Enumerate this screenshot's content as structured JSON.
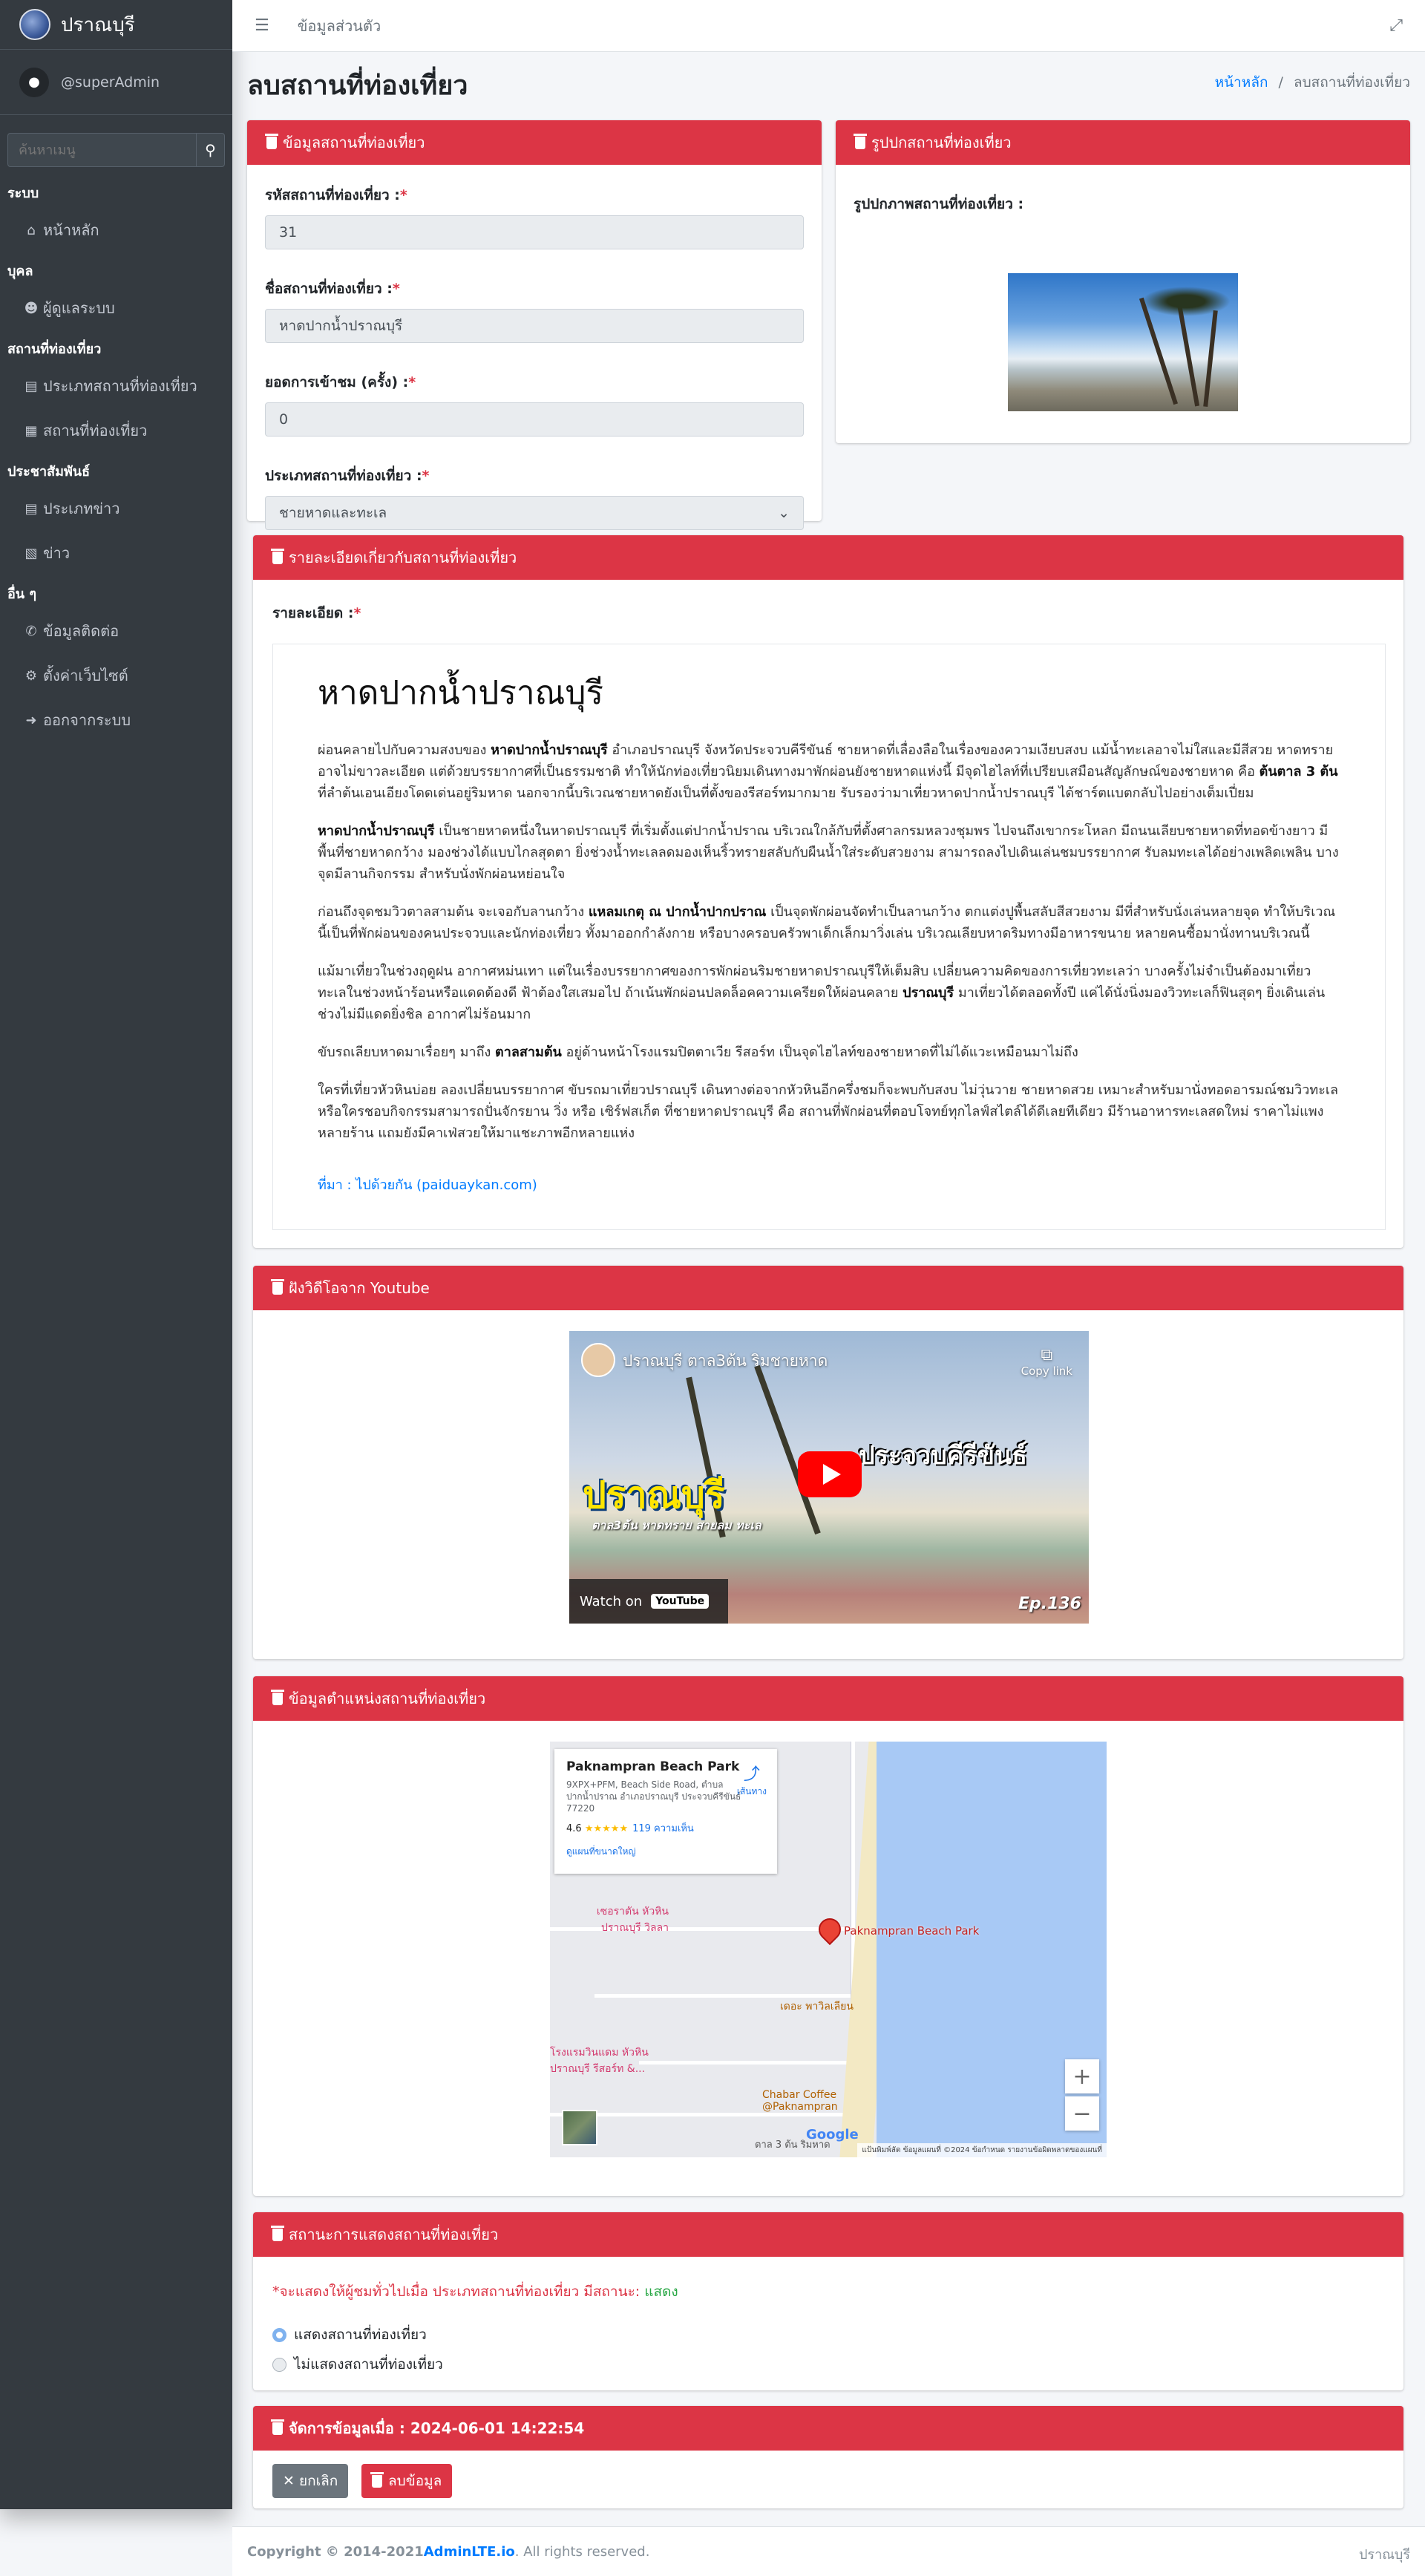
{
  "app": {
    "brand": "ปราณบุรี",
    "user": "@superAdmin"
  },
  "sidebar": {
    "search_placeholder": "ค้นหาเมนู",
    "sections": [
      {
        "header": "ระบบ",
        "items": [
          {
            "label": "หน้าหลัก",
            "icon": "home-icon"
          }
        ]
      },
      {
        "header": "บุคล",
        "items": [
          {
            "label": "ผู้ดูแลระบบ",
            "icon": "users-cog-icon"
          }
        ]
      },
      {
        "header": "สถานที่ท่องเที่ยว",
        "items": [
          {
            "label": "ประเภทสถานที่ท่องเที่ยว",
            "icon": "book-icon"
          },
          {
            "label": "สถานที่ท่องเที่ยว",
            "icon": "map-marked-icon"
          }
        ]
      },
      {
        "header": "ประชาสัมพันธ์",
        "items": [
          {
            "label": "ประเภทข่าว",
            "icon": "book-icon"
          },
          {
            "label": "ข่าว",
            "icon": "newspaper-icon"
          }
        ]
      },
      {
        "header": "อื่น ๆ",
        "items": [
          {
            "label": "ข้อมูลติดต่อ",
            "icon": "phone-icon"
          },
          {
            "label": "ตั้งค่าเว็บไซต์",
            "icon": "cogs-icon"
          },
          {
            "label": "ออกจากระบบ",
            "icon": "sign-out-icon"
          }
        ]
      }
    ]
  },
  "topbar": {
    "link": "ข้อมูลส่วนตัว"
  },
  "page": {
    "title": "ลบสถานที่ท่องเที่ยว",
    "breadcrumb_home": "หน้าหลัก",
    "breadcrumb_sep": "/",
    "breadcrumb_current": "ลบสถานที่ท่องเที่ยว"
  },
  "info_card": {
    "header": "ข้อมูลสถานที่ท่องเที่ยว",
    "id_label": "รหัสสถานที่ท่องเที่ยว :",
    "id_value": "31",
    "name_label": "ชื่อสถานที่ท่องเที่ยว :",
    "name_value": "หาดปากน้ำปราณบุรี",
    "visits_label": "ยอดการเข้าชม (ครั้ง) :",
    "visits_value": "0",
    "type_label": "ประเภทสถานที่ท่องเที่ยว :",
    "type_value": "ชายหาดและทะเล",
    "required_mark": "*"
  },
  "cover_card": {
    "header": "รูปปกสถานที่ท่องเที่ยว",
    "label": "รูปปกภาพสถานที่ท่องเที่ยว :"
  },
  "detail_card": {
    "header": "รายละเอียดเกี่ยวกับสถานที่ท่องเที่ยว",
    "label": "รายละเอียด :",
    "title": "หาดปากน้ำปราณบุรี",
    "p1_a": "ผ่อนคลายไปกับความสงบของ ",
    "p1_b": "หาดปากน้ำปราณบุรี",
    "p1_c": " อำเภอปราณบุรี จังหวัดประจวบคีรีขันธ์  ชายหาดที่เลื่องลือในเรื่องของความเงียบสงบ แม้น้ำทะเลอาจไม่ใสและมีสีสวย หาดทรายอาจไม่ขาวละเอียด แต่ด้วยบรรยากาศที่เป็นธรรมชาติ ทำให้นักท่องเที่ยวนิยมเดินทางมาพักผ่อนยังชายหาดแห่งนี้   มีจุดไฮไลท์ที่เปรียบเสมือนสัญลักษณ์ของชายหาด คือ ",
    "p1_d": "ต้นตาล 3 ต้น",
    "p1_e": " ที่ลำต้นเอนเอียงโดดเด่นอยู่ริมหาด นอกจากนี้บริเวณชายหาดยังเป็นที่ตั้งของรีสอร์ทมากมาย รับรองว่ามาเที่ยวหาดปากน้ำปราณบุรี ได้ชาร์ตแบตกลับไปอย่างเต็มเปี่ยม",
    "p2_a": "หาดปากน้ำปราณบุรี",
    "p2_b": " เป็นชายหาดหนึ่งในหาดปราณบุรี ที่เริ่มตั้งแต่ปากน้ำปราณ บริเวณใกล้กับที่ตั้งศาลกรมหลวงชุมพร ไปจนถึงเขากระโหลก มีถนนเลียบชายหาดที่ทอดข้างยาว   มีพื้นที่ชายหาดกว้าง   มองช่วงได้แบบไกลสุดตา   ยิ่งช่วงน้ำทะเลลดมองเห็นริ้วทรายสลับกับผืนน้ำใส่ระดับสวยงาม   สามารถลงไปเดินเล่นชมบรรยากาศ   รับลมทะเลได้อย่างเพลิดเพลิน บางจุดมีลานกิจกรรม สำหรับนั่งพักผ่อนหย่อนใจ",
    "p3_a": "ก่อนถึงจุดชมวิวตาลสามต้น จะเจอกับลานกว้าง ",
    "p3_b": "แหลมเกตุ ณ ปากน้ำปากปราณ",
    "p3_c": " เป็นจุดพักผ่อนจัดทำเป็นลานกว้าง ตกแต่งปูพื้นสลับสีสวยงาม มีที่สำหรับนั่งเล่นหลายจุด ทำให้บริเวณนี้เป็นที่พักผ่อนของคนประจวบและนักท่องเที่ยว ทั้งมาออกกำลังกาย   หรือบางครอบครัวพาเด็กเล็กมาวิ่งเล่น บริเวณเลียบหาดริมทางมีอาหารขนาย  หลายคนซื้อมานั่งทานบริเวณนี้",
    "p4_a": "แม้มาเที่ยวในช่วงฤดูฝน อากาศหม่นเทา แต่ในเรื่องบรรยากาศของการพักผ่อนริมชายหาดปราณบุรีให้เต็มสิบ เปลี่ยนความคิดของการเที่ยวทะเลว่า บางครั้งไม่จำเป็นต้องมาเที่ยวทะเลในช่วงหน้าร้อนหรือแดดต้องดี ฟ้าต้องใสเสมอไป ถ้าเน้นพักผ่อนปลดล็อคความเครียดให้ผ่อนคลาย ",
    "p4_b": "ปราณบุรี",
    "p4_c": "  มาเที่ยวได้ตลอดทั้งปี แค่ได้นั่งนิ่งมองวิวทะเลก็ฟินสุดๆ ยิ่งเดินเล่นช่วงไม่มีแดดยิ่งชิล อากาศไม่ร้อนมาก",
    "p5_a": "ขับรถเลียบหาดมาเรื่อยๆ มาถึง ",
    "p5_b": "ตาลสามต้น",
    "p5_c": "  อยู่ด้านหน้าโรงแรมปิตตาเวีย รีสอร์ท เป็นจุดไฮไลท์ของชายหาดที่ไม่ได้แวะเหมือนมาไม่ถึง",
    "p6": "ใครที่เที่ยวหัวหินบ่อย ลองเปลี่ยนบรรยากาศ ขับรถมาเที่ยวปราณบุรี เดินทางต่อจากหัวหินอีกครึ่งชมก็จะพบกับสงบ ไม่วุ่นวาย ชายหาดสวย เหมาะสำหรับมานั่งทอดอารมณ์ชมวิวทะเล หรือใครชอบกิจกรรมสามารถปั่นจักรยาน วิ่ง หรือ เซิร์ฟสเก็ต ที่ชายหาดปราณบุรี คือ สถานที่พักผ่อนที่ตอบโจทย์ทุกไลฟ์สไตล์ได้ดีเลยทีเดียว มีร้านอาหารทะเลสดใหม่ ราคาไม่แพงหลายร้าน แถมยังมีคาเฟ่สวยให้มาแชะภาพอีกหลายแห่ง",
    "source": "ที่มา : ไปด้วยกัน (paiduaykan.com)"
  },
  "video_card": {
    "header": "ฝังวิดีโอจาก Youtube",
    "title": "ปราณบุรี ตาล3ต้น ริมชายหาด",
    "copy": "Copy link",
    "big1": "ปราณบุรี",
    "big2": "ประจวบคีรีขันธ์",
    "sub": "ตาล3ต้น หาดทราย สายลม ทะเล",
    "watch": "Watch on",
    "yt": "YouTube",
    "ep": "Ep.136"
  },
  "map_card": {
    "header": "ข้อมูลตำแหน่งสถานที่ท่องเที่ยว",
    "place": "Paknampran Beach Park",
    "address": "9XPX+PFM, Beach Side Road, ตำบล ปากน้ำปราณ อำเภอปราณบุรี ประจวบคีรีขันธ์ 77220",
    "rating": "4.6",
    "stars": "★★★★★",
    "reviews": "119 ความเห็น",
    "larger": "ดูแผนที่ขนาดใหญ่",
    "directions": "เส้นทาง",
    "pin_label": "Paknampran Beach Park",
    "l1": "เซอราตัน หัวหิน ปราณบุรี วิลลา",
    "l2": "เดอะ พาวิลเลียน",
    "l3": "โรงแรมวินแดม หัวหิน ปราณบุรี รีสอร์ท &...",
    "l4": "Chabar Coffee @Paknampran",
    "l5": "ตาล 3 ต้น ริมหาด",
    "google": "Google",
    "footer": "แป้นพิมพ์ลัด  ข้อมูลแผนที่ ©2024  ข้อกำหนด  รายงานข้อผิดพลาดของแผนที่"
  },
  "status_card": {
    "header": "สถานะการแสดงสถานที่ท่องเที่ยว",
    "note": "*จะแสดงให้ผู้ชมทั่วไปเมื่อ ประเภทสถานที่ท่องเที่ยว มีสถานะ:",
    "note_status": "แสดง",
    "opt_show": "แสดงสถานที่ท่องเที่ยว",
    "opt_hide": "ไม่แสดงสถานที่ท่องเที่ยว"
  },
  "manage_card": {
    "header": "จัดการข้อมูลเมื่อ : 2024-06-01 14:22:54",
    "cancel": "✕ ยกเลิก",
    "delete": "ลบข้อมูล"
  },
  "footer": {
    "copy": "Copyright © 2014-2021 ",
    "brand": "AdminLTE.io",
    "rights": ". All rights reserved.",
    "right": "ปราณบุรี"
  },
  "colors": {
    "accent": "#dc3545",
    "sidebar": "#343a40",
    "link": "#007bff"
  }
}
